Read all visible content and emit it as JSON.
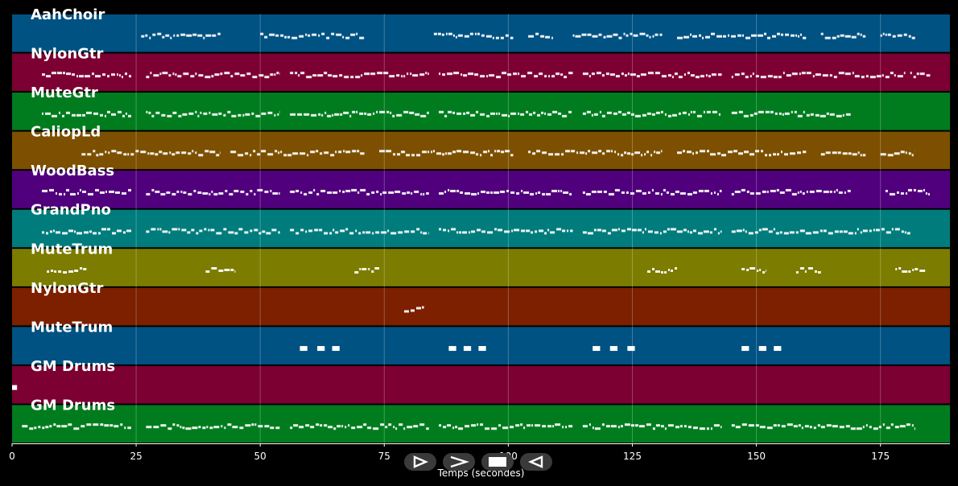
{
  "chart_data": {
    "type": "piano-roll",
    "xlabel": "Temps (secondes)",
    "xlim": [
      0,
      189
    ],
    "x_ticks": [
      0,
      25,
      50,
      75,
      100,
      125,
      150,
      175
    ],
    "grid": true,
    "tracks": [
      {
        "name": "AahChoir",
        "color": "#005282",
        "segments": [
          [
            26,
            42
          ],
          [
            50,
            71
          ],
          [
            85,
            101
          ],
          [
            104,
            109
          ],
          [
            113,
            131
          ],
          [
            134,
            160
          ],
          [
            163,
            172
          ],
          [
            175,
            182
          ]
        ]
      },
      {
        "name": "NylonGtr",
        "color": "#7c0032",
        "segments": [
          [
            6,
            24
          ],
          [
            27,
            54
          ],
          [
            56,
            84
          ],
          [
            86,
            113
          ],
          [
            115,
            143
          ],
          [
            145,
            180
          ],
          [
            181,
            185
          ]
        ]
      },
      {
        "name": "MuteGtr",
        "color": "#007c1e",
        "segments": [
          [
            6,
            24
          ],
          [
            27,
            54
          ],
          [
            56,
            84
          ],
          [
            86,
            113
          ],
          [
            115,
            143
          ],
          [
            145,
            169
          ]
        ]
      },
      {
        "name": "CaliopLd",
        "color": "#7c5000",
        "segments": [
          [
            14,
            42
          ],
          [
            44,
            71
          ],
          [
            74,
            101
          ],
          [
            104,
            131
          ],
          [
            134,
            160
          ],
          [
            163,
            172
          ],
          [
            175,
            182
          ]
        ]
      },
      {
        "name": "WoodBass",
        "color": "#50007c",
        "segments": [
          [
            6,
            24
          ],
          [
            27,
            54
          ],
          [
            56,
            84
          ],
          [
            86,
            113
          ],
          [
            115,
            143
          ],
          [
            145,
            169
          ],
          [
            176,
            185
          ]
        ]
      },
      {
        "name": "GrandPno",
        "color": "#007c7c",
        "segments": [
          [
            6,
            24
          ],
          [
            27,
            54
          ],
          [
            56,
            84
          ],
          [
            86,
            113
          ],
          [
            115,
            143
          ],
          [
            145,
            181
          ]
        ]
      },
      {
        "name": "MuteTrum",
        "color": "#7c7c00",
        "segments": [
          [
            7,
            15
          ],
          [
            39,
            45
          ],
          [
            69,
            74
          ],
          [
            128,
            134
          ],
          [
            147,
            152
          ],
          [
            158,
            163
          ],
          [
            178,
            184
          ]
        ]
      },
      {
        "name": "NylonGtr",
        "color": "#7c2000",
        "segments": [
          [
            79,
            83
          ]
        ]
      },
      {
        "name": "MuteTrum",
        "color": "#005282",
        "segments": [
          [
            58,
            59.5
          ],
          [
            61.5,
            63
          ],
          [
            64.5,
            66
          ],
          [
            88,
            89.5
          ],
          [
            91,
            92.5
          ],
          [
            94,
            95.5
          ],
          [
            117,
            118.5
          ],
          [
            120.5,
            122
          ],
          [
            124,
            125.5
          ],
          [
            147,
            148.5
          ],
          [
            150.5,
            152
          ],
          [
            153.5,
            155
          ]
        ]
      },
      {
        "name": "GM Drums",
        "color": "#7c0032",
        "segments": [
          [
            0,
            1
          ]
        ]
      },
      {
        "name": "GM Drums",
        "color": "#007c1e",
        "segments": [
          [
            2,
            24
          ],
          [
            27,
            54
          ],
          [
            56,
            84
          ],
          [
            86,
            113
          ],
          [
            115,
            143
          ],
          [
            145,
            182
          ]
        ]
      }
    ]
  },
  "controls": [
    {
      "name": "play",
      "icon": "play-icon"
    },
    {
      "name": "forward",
      "icon": "chevron-right-icon"
    },
    {
      "name": "stop",
      "icon": "stop-icon"
    },
    {
      "name": "back",
      "icon": "play-back-icon"
    }
  ]
}
